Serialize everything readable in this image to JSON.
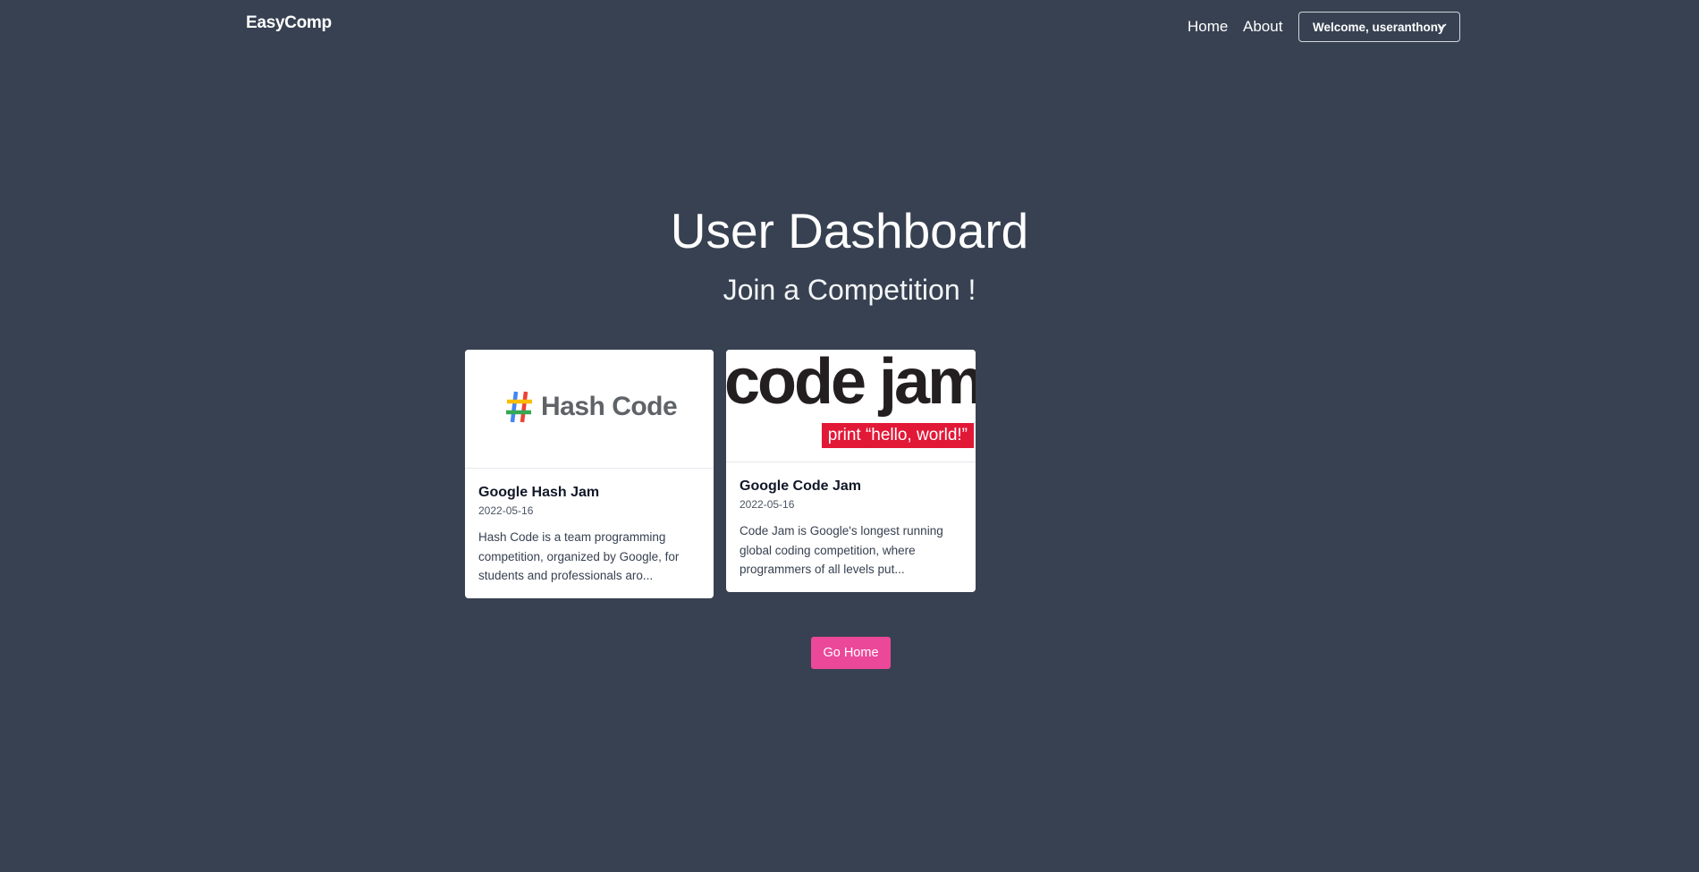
{
  "nav": {
    "brand": "EasyComp",
    "links": [
      {
        "label": "Home"
      },
      {
        "label": "About"
      }
    ],
    "user_menu_label": "Welcome, useranthony"
  },
  "page": {
    "title": "User Dashboard",
    "subtitle": "Join a Competition !"
  },
  "competitions": [
    {
      "title": "Google Hash Jam",
      "date": "2022-05-16",
      "description": "Hash Code is a team programming competition, organized by Google, for students and professionals aro...",
      "image_text": "Hash Code"
    },
    {
      "title": "Google Code Jam",
      "date": "2022-05-16",
      "description": "Code Jam is Google's longest running global coding competition, where programmers of all levels put...",
      "image_text": "code jam",
      "image_tagline": "print “hello, world!”"
    }
  ],
  "actions": {
    "go_home_label": "Go Home"
  },
  "colors": {
    "background": "#374151",
    "accent": "#ec4899",
    "codejam_red": "#e21837"
  }
}
